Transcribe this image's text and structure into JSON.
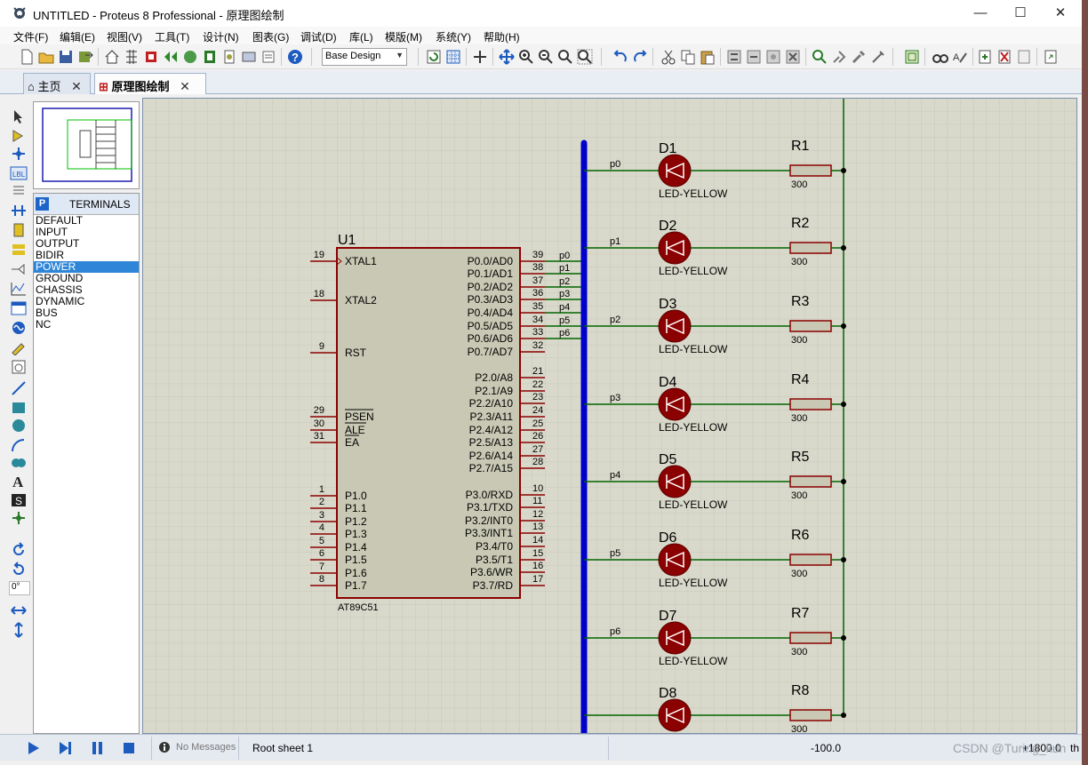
{
  "window": {
    "title": "UNTITLED - Proteus 8 Professional - 原理图绘制",
    "minimize": "—",
    "maximize": "☐",
    "close": "✕"
  },
  "menu": [
    "文件(F)",
    "编辑(E)",
    "视图(V)",
    "工具(T)",
    "设计(N)",
    "图表(G)",
    "调试(D)",
    "库(L)",
    "模版(M)",
    "系统(Y)",
    "帮助(H)"
  ],
  "toolbar": {
    "design_select": "Base Design"
  },
  "tabs": [
    {
      "label": "主页",
      "icon": "home-icon",
      "close": "✕"
    },
    {
      "label": "原理图绘制",
      "icon": "schematic-icon",
      "close": "✕"
    }
  ],
  "left_tools": {
    "angle_value": "0°"
  },
  "terminals": {
    "badge": "P",
    "title": "TERMINALS",
    "items": [
      "DEFAULT",
      "INPUT",
      "OUTPUT",
      "BIDIR",
      "POWER",
      "GROUND",
      "CHASSIS",
      "DYNAMIC",
      "BUS",
      "NC"
    ],
    "selected": "POWER"
  },
  "schematic": {
    "chip": {
      "ref": "U1",
      "part": "AT89C51",
      "left_pins": [
        {
          "num": "19",
          "name": "XTAL1"
        },
        {
          "num": "18",
          "name": "XTAL2"
        },
        {
          "num": "9",
          "name": "RST"
        },
        {
          "num": "29",
          "name": "PSEN"
        },
        {
          "num": "30",
          "name": "ALE"
        },
        {
          "num": "31",
          "name": "EA"
        },
        {
          "num": "1",
          "name": "P1.0"
        },
        {
          "num": "2",
          "name": "P1.1"
        },
        {
          "num": "3",
          "name": "P1.2"
        },
        {
          "num": "4",
          "name": "P1.3"
        },
        {
          "num": "5",
          "name": "P1.4"
        },
        {
          "num": "6",
          "name": "P1.5"
        },
        {
          "num": "7",
          "name": "P1.6"
        },
        {
          "num": "8",
          "name": "P1.7"
        }
      ],
      "right_pins": [
        {
          "num": "39",
          "name": "P0.0/AD0",
          "net": "p0"
        },
        {
          "num": "38",
          "name": "P0.1/AD1",
          "net": "p1"
        },
        {
          "num": "37",
          "name": "P0.2/AD2",
          "net": "p2"
        },
        {
          "num": "36",
          "name": "P0.3/AD3",
          "net": "p3"
        },
        {
          "num": "35",
          "name": "P0.4/AD4",
          "net": "p4"
        },
        {
          "num": "34",
          "name": "P0.5/AD5",
          "net": "p5"
        },
        {
          "num": "33",
          "name": "P0.6/AD6",
          "net": "p6"
        },
        {
          "num": "32",
          "name": "P0.7/AD7",
          "net": ""
        },
        {
          "num": "21",
          "name": "P2.0/A8",
          "net": ""
        },
        {
          "num": "22",
          "name": "P2.1/A9",
          "net": ""
        },
        {
          "num": "23",
          "name": "P2.2/A10",
          "net": ""
        },
        {
          "num": "24",
          "name": "P2.3/A11",
          "net": ""
        },
        {
          "num": "25",
          "name": "P2.4/A12",
          "net": ""
        },
        {
          "num": "26",
          "name": "P2.5/A13",
          "net": ""
        },
        {
          "num": "27",
          "name": "P2.6/A14",
          "net": ""
        },
        {
          "num": "28",
          "name": "P2.7/A15",
          "net": ""
        },
        {
          "num": "10",
          "name": "P3.0/RXD",
          "net": ""
        },
        {
          "num": "11",
          "name": "P3.1/TXD",
          "net": ""
        },
        {
          "num": "12",
          "name": "P3.2/INT0",
          "net": ""
        },
        {
          "num": "13",
          "name": "P3.3/INT1",
          "net": ""
        },
        {
          "num": "14",
          "name": "P3.4/T0",
          "net": ""
        },
        {
          "num": "15",
          "name": "P3.5/T1",
          "net": ""
        },
        {
          "num": "16",
          "name": "P3.6/WR",
          "net": ""
        },
        {
          "num": "17",
          "name": "P3.7/RD",
          "net": ""
        }
      ]
    },
    "leds": [
      {
        "ref": "D1",
        "value": "LED-YELLOW",
        "net": "p0",
        "res": "R1",
        "res_value": "300"
      },
      {
        "ref": "D2",
        "value": "LED-YELLOW",
        "net": "p1",
        "res": "R2",
        "res_value": "300"
      },
      {
        "ref": "D3",
        "value": "LED-YELLOW",
        "net": "p2",
        "res": "R3",
        "res_value": "300"
      },
      {
        "ref": "D4",
        "value": "LED-YELLOW",
        "net": "p3",
        "res": "R4",
        "res_value": "300"
      },
      {
        "ref": "D5",
        "value": "LED-YELLOW",
        "net": "p4",
        "res": "R5",
        "res_value": "300"
      },
      {
        "ref": "D6",
        "value": "LED-YELLOW",
        "net": "p5",
        "res": "R6",
        "res_value": "300"
      },
      {
        "ref": "D7",
        "value": "LED-YELLOW",
        "net": "p6",
        "res": "R7",
        "res_value": "300"
      },
      {
        "ref": "D8",
        "value": "",
        "net": "",
        "res": "R8",
        "res_value": "300"
      }
    ],
    "colors": {
      "wire": "#006400",
      "component": "#8b0000",
      "body": "#c8c8b4",
      "bus": "#0000cd",
      "led_fill": "#8b0000",
      "sheet": "#d9d9cb"
    }
  },
  "status": {
    "messages": "No Messages",
    "sheet": "Root sheet 1",
    "coord_x": "-100.0",
    "coord_y": "+1800.0",
    "unit": "th"
  },
  "watermark": "CSDN @Turing_kun"
}
